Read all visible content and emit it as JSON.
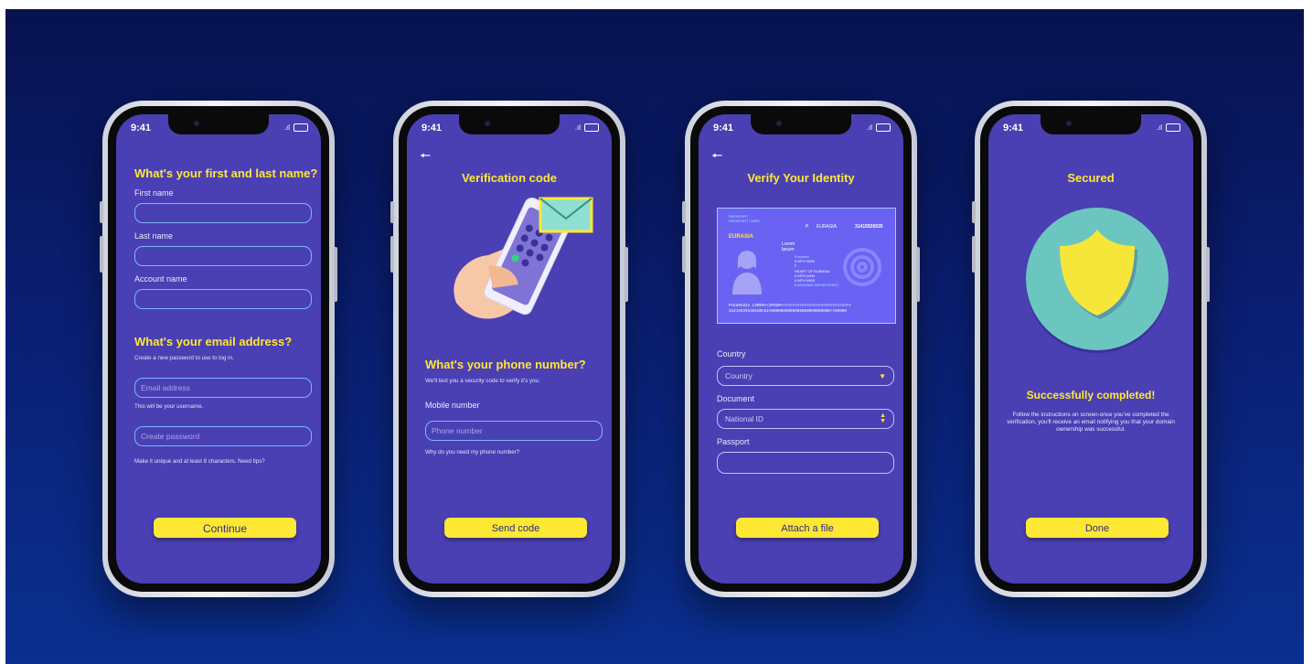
{
  "status": {
    "time": "9:41",
    "signal": ".ıl"
  },
  "screens": [
    {
      "heading_name": "What's your first and last name?",
      "first_name_label": "First name",
      "last_name_label": "Last name",
      "account_name_label": "Account name",
      "heading_email": "What's your email address?",
      "email_sub": "Create a new password to use to log in.",
      "email_placeholder": "Email address",
      "email_hint": "This will be your username.",
      "password_placeholder": "Create password",
      "password_hint": "Make it unique and at least 8 characters. Need tips?",
      "cta": "Continue"
    },
    {
      "title": "Verification code",
      "heading": "What's your phone number?",
      "sub": "We'll text you a security code to verify it's you.",
      "mobile_label": "Mobile number",
      "phone_placeholder": "Phone number",
      "why": "Why do you need my phone number?",
      "cta": "Send code"
    },
    {
      "title": "Verify Your Identity",
      "passport": {
        "header_line1": "PASSPORT",
        "header_line2": "PASSPORT CARD",
        "type": "P",
        "country": "EURASIA",
        "number": "31415926535",
        "issuer": "EURASIA",
        "surname": "Lorem",
        "given": "Ipsum",
        "line1": "Eurasian",
        "line2": "0 MTH 0000",
        "line3": "F",
        "line4": "HEART OF EURASIA",
        "line5": "0 MTH 0000",
        "line6": "0 MTH 0000",
        "dept": "EURASIAN DEPARTMENT",
        "mrz1": "P<EURASIA LOREM<<IPSUM<<<<<<<<<<<<<<<<<<<<<<<<<<<<<<",
        "mrz2": "31415926535EURASIA0000000000000000000000000<<00000"
      },
      "country_label": "Country",
      "country_value": "Country",
      "document_label": "Document",
      "document_value": "National ID",
      "passport_label": "Passport",
      "cta": "Attach a file"
    },
    {
      "title": "Secured",
      "heading": "Successfully completed!",
      "body": "Follow the instructions on screen-once you've completed the verification, you'll receive an email notifying you that your domain ownership was successful.",
      "cta": "Done"
    }
  ],
  "colors": {
    "screen": "#4a3fb3",
    "accent": "#ffe834",
    "teal": "#6cc6c0",
    "background": "#0a1e72"
  }
}
